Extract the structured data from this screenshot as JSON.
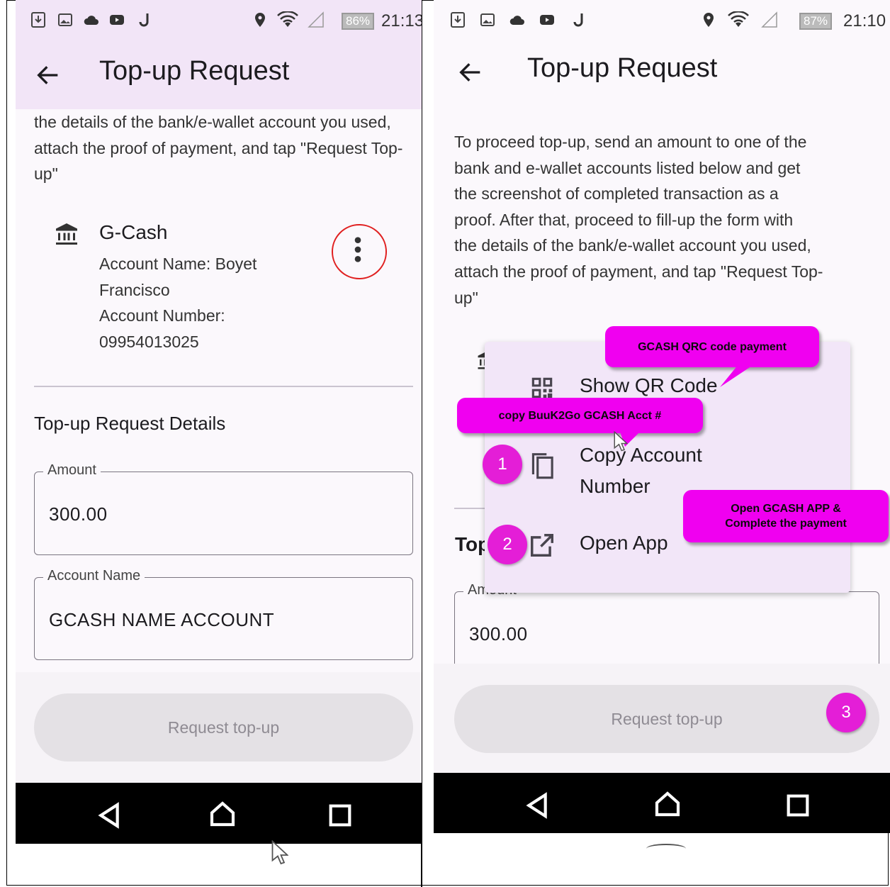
{
  "left": {
    "status_bar": {
      "battery": "86%",
      "time": "21:13"
    },
    "app_bar": {
      "title": "Top-up Request"
    },
    "instructions_partial": [
      "the details of the bank/e-wallet account you used,",
      "attach the proof of payment, and tap \"Request Top-",
      "up\""
    ],
    "account": {
      "name": "G-Cash",
      "lines": [
        "Account Name: Boyet",
        "Francisco",
        "Account Number:",
        "09954013025"
      ]
    },
    "section_title": "Top-up Request Details",
    "amount": {
      "label": "Amount",
      "value": "300.00"
    },
    "account_name": {
      "label": "Account Name",
      "value": "GCASH NAME ACCOUNT"
    },
    "request_button": "Request top-up"
  },
  "right": {
    "status_bar": {
      "battery": "87%",
      "time": "21:10"
    },
    "app_bar": {
      "title": "Top-up Request"
    },
    "instructions": [
      "To proceed top-up, send an amount to one of the",
      "bank and e-wallet accounts listed below and get",
      "the screenshot of completed transaction as a",
      "proof. After that, proceed to fill-up the form with",
      "the details of the bank/e-wallet account you used,",
      "attach the proof of payment, and tap \"Request Top-",
      "up\""
    ],
    "menu": {
      "show_qr": "Show QR Code",
      "copy_account": [
        "Copy Account",
        "Number"
      ],
      "open_app": "Open App"
    },
    "partial_section_title": "Top",
    "amount": {
      "label": "Amount",
      "value": "300.00"
    },
    "request_button": "Request top-up",
    "callouts": {
      "qr": "GCASH QRC code payment",
      "copy": "copy BuuK2Go GCASH Acct #",
      "open": [
        "Open GCASH APP &",
        "Complete the payment"
      ]
    },
    "badges": [
      "1",
      "2",
      "3"
    ]
  },
  "colors": {
    "callout": "#f000f0",
    "badge": "#e41ed7",
    "appbar_left": "#f2e5f7",
    "menu_bg": "#f2e6f8",
    "highlight_circle": "#e02020"
  }
}
